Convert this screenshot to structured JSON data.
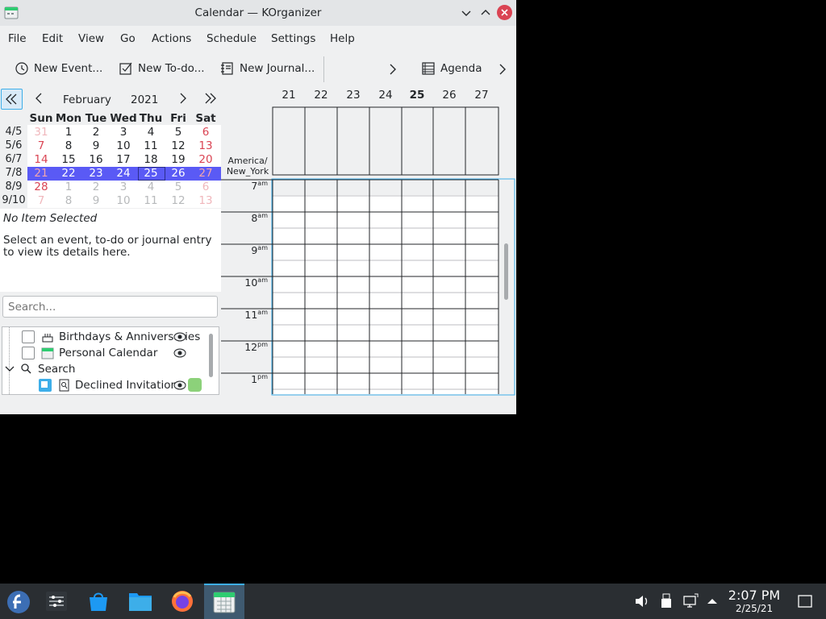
{
  "window": {
    "title": "Calendar — KOrganizer"
  },
  "menu": [
    "File",
    "Edit",
    "View",
    "Go",
    "Actions",
    "Schedule",
    "Settings",
    "Help"
  ],
  "toolbar": {
    "new_event": "New Event...",
    "new_todo": "New To-do...",
    "new_journal": "New Journal...",
    "agenda": "Agenda"
  },
  "navigator": {
    "month": "February",
    "year": "2021",
    "day_headers": [
      "Sun",
      "Mon",
      "Tue",
      "Wed",
      "Thu",
      "Fri",
      "Sat"
    ],
    "weeks": [
      {
        "week": "4/5",
        "days": [
          "31",
          "1",
          "2",
          "3",
          "4",
          "5",
          "6"
        ]
      },
      {
        "week": "5/6",
        "days": [
          "7",
          "8",
          "9",
          "10",
          "11",
          "12",
          "13"
        ]
      },
      {
        "week": "6/7",
        "days": [
          "14",
          "15",
          "16",
          "17",
          "18",
          "19",
          "20"
        ]
      },
      {
        "week": "7/8",
        "days": [
          "21",
          "22",
          "23",
          "24",
          "25",
          "26",
          "27"
        ]
      },
      {
        "week": "8/9",
        "days": [
          "28",
          "1",
          "2",
          "3",
          "4",
          "5",
          "6"
        ]
      },
      {
        "week": "9/10",
        "days": [
          "7",
          "8",
          "9",
          "10",
          "11",
          "12",
          "13"
        ]
      }
    ]
  },
  "details": {
    "title": "No Item Selected",
    "body": "Select an event, to-do or journal entry to view its details here."
  },
  "search": {
    "placeholder": "Search..."
  },
  "calendars": {
    "birthdays": "Birthdays & Anniversaries",
    "personal": "Personal Calendar",
    "search": "Search",
    "declined": "Declined Invitations",
    "declined_color": "#8cd17a"
  },
  "agenda": {
    "days": [
      "21",
      "22",
      "23",
      "24",
      "25",
      "26",
      "27"
    ],
    "today": "25",
    "timezone_line1": "America/",
    "timezone_line2": "New_York",
    "hours": [
      {
        "h": "7",
        "ap": "am"
      },
      {
        "h": "8",
        "ap": "am"
      },
      {
        "h": "9",
        "ap": "am"
      },
      {
        "h": "10",
        "ap": "am"
      },
      {
        "h": "11",
        "ap": "am"
      },
      {
        "h": "12",
        "ap": "pm"
      },
      {
        "h": "1",
        "ap": "pm"
      }
    ]
  },
  "taskbar": {
    "time": "2:07 PM",
    "date": "2/25/21"
  },
  "colors": {
    "accent": "#3daee9",
    "week_highlight": "#5a5af5",
    "weekend": "#da4453"
  }
}
